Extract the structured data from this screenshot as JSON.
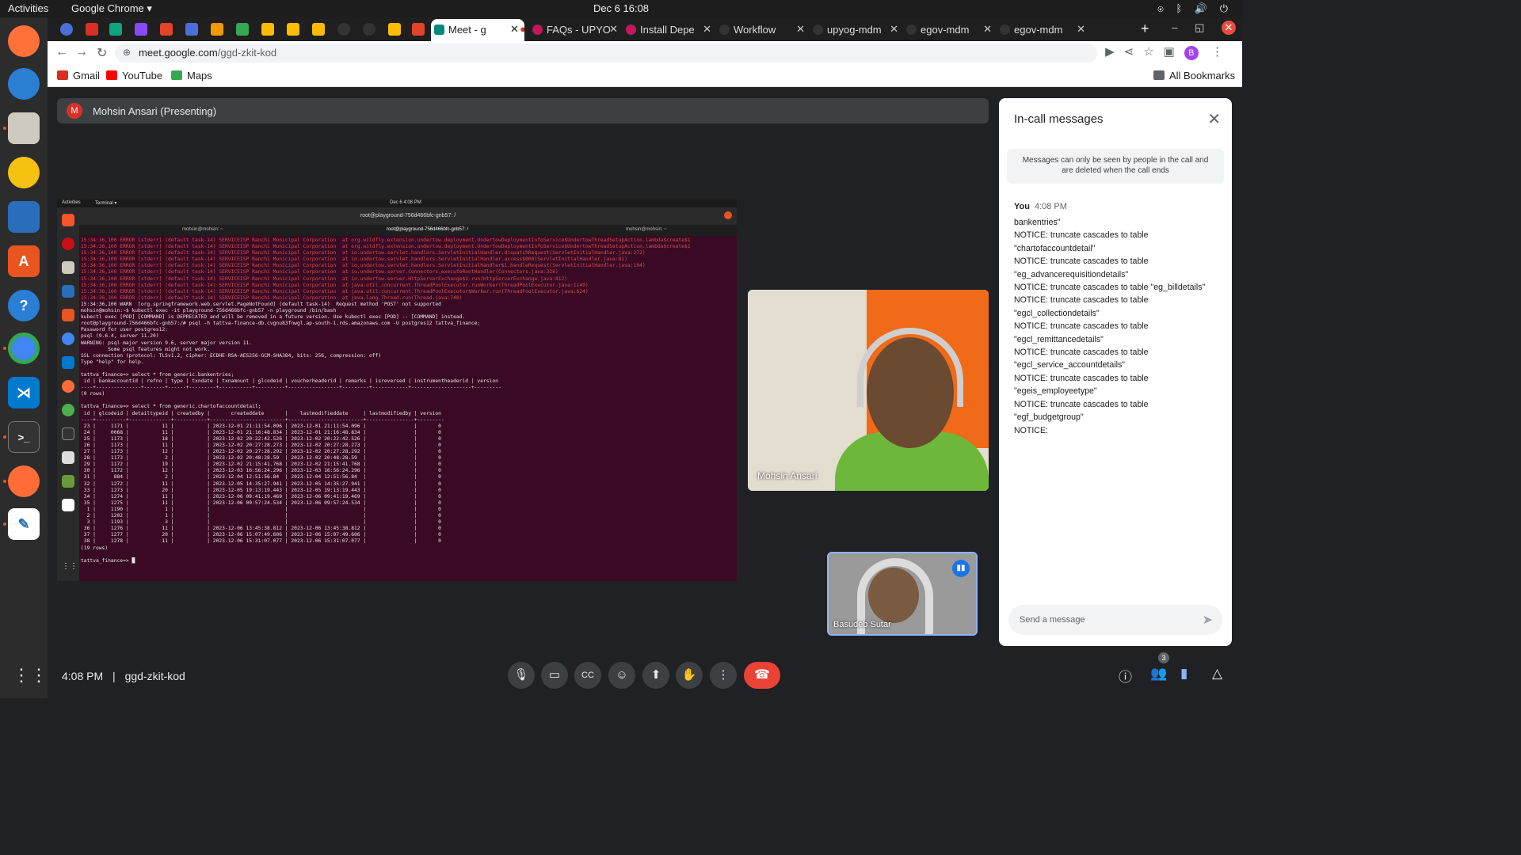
{
  "topbar": {
    "activities": "Activities",
    "app": "Google Chrome ▾",
    "clock": "Dec 6  16:08"
  },
  "chrome": {
    "tabs": [
      {
        "label": "Meet - g",
        "active": true
      },
      {
        "label": "FAQs - UPYO",
        "active": false
      },
      {
        "label": "Install Depe",
        "active": false
      },
      {
        "label": "Workflow",
        "active": false
      },
      {
        "label": "upyog-mdm",
        "active": false
      },
      {
        "label": "egov-mdm",
        "active": false
      },
      {
        "label": "egov-mdm",
        "active": false
      }
    ],
    "url_host": "meet.google.com",
    "url_path": "/ggd-zkit-kod",
    "avatar": "B",
    "bookmarks": [
      "Gmail",
      "YouTube",
      "Maps"
    ],
    "all_bookmarks": "All Bookmarks"
  },
  "meet": {
    "presenter_initial": "M",
    "presenter": "Mohsin Ansari (Presenting)",
    "participant_main": "Mohsin Ansari",
    "participant_small": "Basudeb Sutar",
    "time": "4:08 PM",
    "separator": "|",
    "meeting_code": "ggd-zkit-kod",
    "people_count": "3"
  },
  "shared_screen": {
    "topbar_left": "Activities",
    "topbar_app": "Terminal ▾",
    "topbar_clock": "Dec 6  4:08 PM",
    "terminal_title": "root@playground-756d466bfc-gnb57: /",
    "tabs": [
      "mohsin@mohsin: ~",
      "root@playground-756d466bfc-gnb57: /",
      "mohsin@mohsin: ~"
    ],
    "error_lines": [
      "15:34:36,100 ERROR [stderr] (default task-14) SERVICEISP Ranchi Municipal Corporation  at org.wildfly.extension.undertow.deployment.UndertowDeploymentInfoService$UndertowThreadSetupAction.lambda$create$1",
      "15:34:36,100 ERROR [stderr] (default task-14) SERVICEISP Ranchi Municipal Corporation  at org.wildfly.extension.undertow.deployment.UndertowDeploymentInfoService$UndertowThreadSetupAction.lambda$create$1",
      "15:34:36,100 ERROR [stderr] (default task-14) SERVICEISP Ranchi Municipal Corporation  at io.undertow.servlet.handlers.ServletInitialHandler.dispatchRequest(ServletInitialHandler.java:272)",
      "15:34:36,100 ERROR [stderr] (default task-14) SERVICEISP Ranchi Municipal Corporation  at io.undertow.servlet.handlers.ServletInitialHandler.access$000(ServletInitialHandler.java:81)",
      "15:34:36,100 ERROR [stderr] (default task-14) SERVICEISP Ranchi Municipal Corporation  at io.undertow.servlet.handlers.ServletInitialHandler$1.handleRequest(ServletInitialHandler.java:104)",
      "15:34:36,100 ERROR [stderr] (default task-14) SERVICEISP Ranchi Municipal Corporation  at io.undertow.server.Connectors.executeRootHandler(Connectors.java:326)",
      "15:34:36,100 ERROR [stderr] (default task-14) SERVICEISP Ranchi Municipal Corporation  at io.undertow.server.HttpServerExchange$1.run(HttpServerExchange.java:812)",
      "15:34:36,100 ERROR [stderr] (default task-14) SERVICEISP Ranchi Municipal Corporation  at java.util.concurrent.ThreadPoolExecutor.runWorker(ThreadPoolExecutor.java:1149)",
      "15:34:36,100 ERROR [stderr] (default task-14) SERVICEISP Ranchi Municipal Corporation  at java.util.concurrent.ThreadPoolExecutor$Worker.run(ThreadPoolExecutor.java:624)",
      "15:34:36,100 ERROR [stderr] (default task-14) SERVICEISP Ranchi Municipal Corporation  at java.lang.Thread.run(Thread.java:748)"
    ],
    "lines": [
      "15:34:36,100 WARN  [org.springframework.web.servlet.PageNotFound] (default task-14)  Request method 'POST' not supported",
      "mohsin@mohsin:~$ kubectl exec -it playground-756d466bfc-gnb57 -n playground /bin/bash",
      "kubectl exec [POD] [COMMAND] is DEPRECATED and will be removed in a future version. Use kubectl exec [POD] -- [COMMAND] instead.",
      "root@playground-756d466bfc-gnb57:/# psql -h tattva-finance-db.cvgnu83fnwgl.ap-south-1.rds.amazonaws.com -U postgres12 tattva_finance;",
      "Password for user postgres12:",
      "psql (9.6.4, server 11.20)",
      "WARNING: psql major version 9.6, server major version 11.",
      "         Some psql features might not work.",
      "SSL connection (protocol: TLSv1.2, cipher: ECDHE-RSA-AES256-GCM-SHA384, bits: 256, compression: off)",
      "Type \"help\" for help.",
      "",
      "tattva_finance=> select * from generic.bankentries;",
      " id | bankaccountid | refno | type | txndate | txnamount | glcodeid | voucherheaderid | remarks | isreversed | instrumentheaderid | version",
      "----+---------------+-------+------+---------+-----------+----------+-----------------+---------+------------+--------------------+---------",
      "(0 rows)",
      "",
      "tattva_finance=> select * from generic.chartofaccountdetail;",
      " id | glcodeid | detailtypeid | createdby |       createddate       |    lastmodifieddate     | lastmodifiedby | version",
      "----+----------+--------------+-----------+-------------------------+-------------------------+----------------+---------",
      " 23 |     1171 |           11 |           | 2023-12-01 21:11:54.096 | 2023-12-01 21:11:54.096 |                |       0",
      " 24 |     0068 |           11 |           | 2023-12-01 21:16:48.834 | 2023-12-01 21:16:48.834 |                |       0",
      " 25 |     1173 |           18 |           | 2023-12-02 20:22:42.526 | 2023-12-02 20:22:42.526 |                |       0",
      " 26 |     1173 |           11 |           | 2023-12-02 20:27:28.273 | 2023-12-02 20:27:28.273 |                |       0",
      " 27 |     1173 |           12 |           | 2023-12-02 20:27:28.292 | 2023-12-02 20:27:28.292 |                |       0",
      " 28 |     1173 |            2 |           | 2023-12-02 20:48:28.59  | 2023-12-02 20:48:28.59  |                |       0",
      " 29 |     1172 |           19 |           | 2023-12-02 21:15:41.768 | 2023-12-02 21:15:41.768 |                |       0",
      " 30 |     1172 |           12 |           | 2023-12-03 16:56:24.296 | 2023-12-03 16:56:24.296 |                |       0",
      " 31 |      884 |            2 |           | 2023-12-04 12:51:56.84  | 2023-12-04 12:51:56.84  |                |       0",
      " 32 |     1272 |           11 |           | 2023-12-05 14:35:27.941 | 2023-12-05 14:35:27.941 |                |       0",
      " 33 |     1273 |           20 |           | 2023-12-05 19:13:19.443 | 2023-12-05 19:13:19.443 |                |       0",
      " 34 |     1274 |           11 |           | 2023-12-06 09:41:19.469 | 2023-12-06 09:41:19.469 |                |       0",
      " 35 |     1275 |           11 |           | 2023-12-06 09:57:24.534 | 2023-12-06 09:57:24.534 |                |       0",
      "  1 |     1190 |            1 |           |                         |                         |                |       0",
      "  2 |     1202 |            1 |           |                         |                         |                |       0",
      "  3 |     1193 |            3 |           |                         |                         |                |       0",
      " 36 |     1276 |           11 |           | 2023-12-06 13:45:38.812 | 2023-12-06 13:45:38.812 |                |       0",
      " 37 |     1277 |           20 |           | 2023-12-06 15:07:49.606 | 2023-12-06 15:07:49.606 |                |       0",
      " 38 |     1278 |           11 |           | 2023-12-06 15:31:07.077 | 2023-12-06 15:31:07.077 |                |       0",
      "(19 rows)",
      "",
      "tattva_finance=> █"
    ]
  },
  "panel": {
    "title": "In-call messages",
    "notice": "Messages can only be seen by people in the call and are deleted when the call ends",
    "sender": "You",
    "time": "4:08 PM",
    "messages": [
      "bankentries\"",
      "NOTICE:  truncate cascades to table",
      "\"chartofaccountdetail\"",
      "NOTICE:  truncate cascades to table",
      "\"eg_advancerequisitiondetails\"",
      "NOTICE:  truncate cascades to table \"eg_billdetails\"",
      "NOTICE:  truncate cascades to table",
      "\"egcl_collectiondetails\"",
      "NOTICE:  truncate cascades to table",
      "\"egcl_remittancedetails\"",
      "NOTICE:  truncate cascades to table",
      "\"egcl_service_accountdetails\"",
      "NOTICE:  truncate cascades to table",
      "\"egeis_employeetype\"",
      "NOTICE:  truncate cascades to table",
      "\"egf_budgetgroup\"",
      "NOTICE:"
    ],
    "input_placeholder": "Send a message"
  },
  "colors": {
    "accent": "#1a73e8",
    "end_call": "#ea4335",
    "terminal_bg": "#3a0a24",
    "error_text": "#d14f4f"
  }
}
